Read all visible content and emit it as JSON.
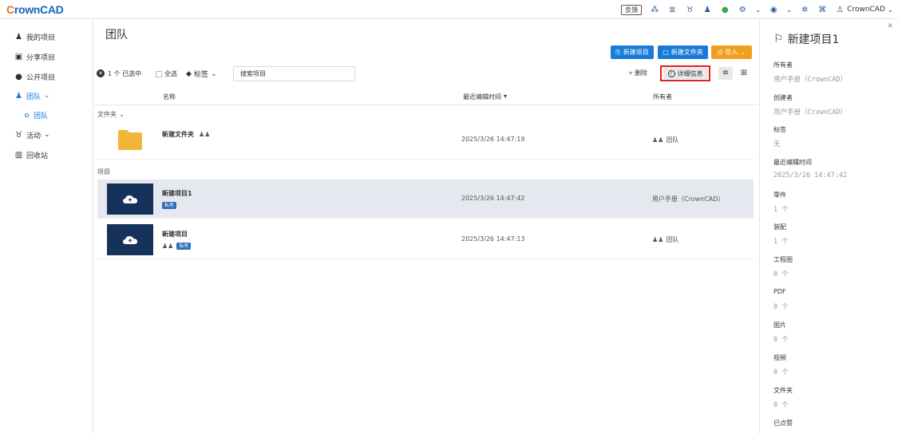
{
  "app": {
    "logo_initial": "C",
    "logo_rest": "rownCAD"
  },
  "topbar": {
    "feedback": "反馈",
    "user": "CrownCAD"
  },
  "sidebar": {
    "items": [
      {
        "label": "我的项目",
        "icon": "person-icon"
      },
      {
        "label": "分享项目",
        "icon": "share-icon"
      },
      {
        "label": "公开项目",
        "icon": "globe-icon"
      },
      {
        "label": "团队",
        "icon": "team-icon"
      },
      {
        "label": "活动",
        "icon": "trophy-icon"
      },
      {
        "label": "回收站",
        "icon": "trash-icon"
      }
    ],
    "sub_item": "团队",
    "active_color": "#1a7ad9"
  },
  "main": {
    "title": "团队",
    "buttons": {
      "new_project": "新建项目",
      "new_folder": "新建文件夹",
      "import": "导入"
    },
    "toolbar": {
      "selected": "1 个 已选中",
      "select_all": "全选",
      "tags": "标签",
      "search_value": "搜索项目",
      "delete": "删除",
      "details": "详细信息"
    },
    "columns": {
      "name": "名称",
      "modified": "最近编辑时间",
      "owner": "所有者"
    },
    "folders_label": "文件夹",
    "projects_label": "项目",
    "folders": [
      {
        "name": "新建文件夹",
        "modified": "2025/3/26 14:47:19",
        "owner": "团队"
      }
    ],
    "projects": [
      {
        "name": "新建项目1",
        "badge": "私有",
        "modified": "2025/3/26 14:47:42",
        "owner": "用户手册（CrownCAD）"
      },
      {
        "name": "新建项目",
        "badge": "私有",
        "modified": "2025/3/26 14:47:13",
        "owner": "团队"
      }
    ]
  },
  "panel": {
    "title": "新建项目1",
    "fields": [
      {
        "label": "所有者",
        "value": "用户手册（CrownCAD）"
      },
      {
        "label": "创建者",
        "value": "用户手册（CrownCAD）"
      },
      {
        "label": "标签",
        "value": "无"
      },
      {
        "label": "最近编辑时间",
        "value": "2025/3/26 14:47:42"
      },
      {
        "label": "零件",
        "value": "1 个"
      },
      {
        "label": "装配",
        "value": "1 个"
      },
      {
        "label": "工程图",
        "value": "0 个"
      },
      {
        "label": "PDF",
        "value": "0 个"
      },
      {
        "label": "图片",
        "value": "0 个"
      },
      {
        "label": "视频",
        "value": "0 个"
      },
      {
        "label": "文件夹",
        "value": "0 个"
      },
      {
        "label": "已点赞",
        "value": ""
      }
    ]
  },
  "colors": {
    "primary": "#1a7ad9",
    "import": "#f0a020",
    "highlight": "#e02020",
    "thumb": "#17325a",
    "private_badge": "#2f6fb8"
  }
}
